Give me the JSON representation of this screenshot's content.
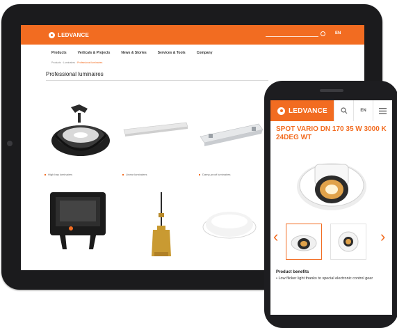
{
  "brand": {
    "name": "LEDVANCE",
    "accent": "#f26c21"
  },
  "tablet": {
    "lang": "EN",
    "nav": [
      {
        "label": "Products"
      },
      {
        "label": "Verticals & Projects"
      },
      {
        "label": "News & Stories"
      },
      {
        "label": "Services & Tools"
      },
      {
        "label": "Company"
      }
    ],
    "breadcrumb": {
      "parent": "Products · Luminaires ·",
      "current": "Professional luminaires"
    },
    "heading": "Professional luminaires",
    "products": [
      {
        "caption": "High bay luminaires",
        "icon": "high-bay-luminaire-icon"
      },
      {
        "caption": "Linear luminaires",
        "icon": "linear-luminaire-icon"
      },
      {
        "caption": "Damp-proof luminaires",
        "icon": "damp-proof-luminaire-icon"
      },
      {
        "caption": "",
        "icon": "floodlight-icon"
      },
      {
        "caption": "",
        "icon": "pendant-luminaire-icon"
      },
      {
        "caption": "",
        "icon": "downlight-icon"
      }
    ]
  },
  "phone": {
    "lang": "EN",
    "product_title": "SPOT VARIO DN 170 35 W 3000 K 24DEG WT",
    "benefits_title": "Product benefits",
    "benefits": [
      "Low flicker light thanks to special electronic control gear"
    ]
  }
}
